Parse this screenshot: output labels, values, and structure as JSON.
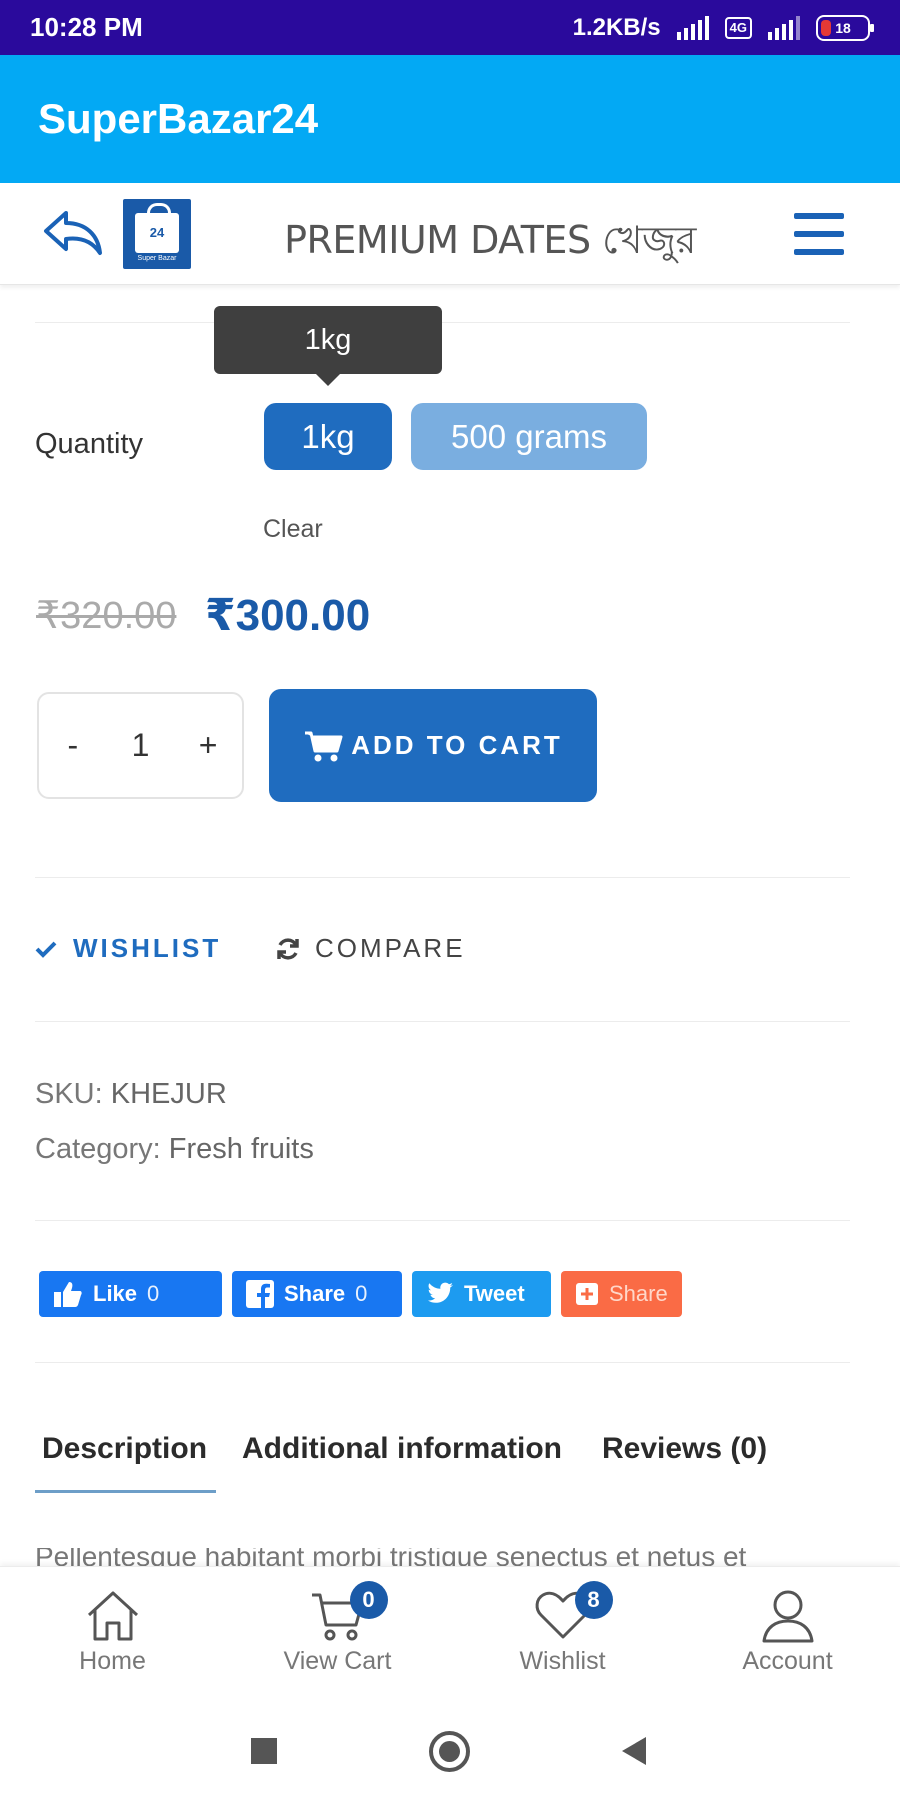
{
  "status_bar": {
    "time": "10:28 PM",
    "net_speed": "1.2KB/s",
    "lte": "4G",
    "battery": "18"
  },
  "app_bar": {
    "title": "SuperBazar24"
  },
  "header": {
    "title": "PREMIUM DATES খেজুর",
    "logo_number": "24",
    "logo_caption": "Super Bazar"
  },
  "tooltip": {
    "text": "1kg"
  },
  "quantity": {
    "label": "Quantity",
    "options": [
      {
        "label": "1kg",
        "selected": true
      },
      {
        "label": "500 grams",
        "selected": false
      }
    ],
    "clear_label": "Clear"
  },
  "price": {
    "old": "₹320.00",
    "new": "₹300.00"
  },
  "stepper": {
    "minus": "-",
    "value": "1",
    "plus": "+"
  },
  "cart": {
    "add_label": "ADD TO CART",
    "icon": "cart-icon"
  },
  "actions": {
    "wishlist_label": "WISHLIST",
    "compare_label": "COMPARE"
  },
  "meta": {
    "sku_label": "SKU:",
    "sku_value": "KHEJUR",
    "category_label": "Category:",
    "category_value": "Fresh fruits"
  },
  "share": {
    "fb_like_label": "Like",
    "fb_like_count": "0",
    "fb_share_label": "Share",
    "fb_share_count": "0",
    "tweet_label": "Tweet",
    "generic_share_label": "Share"
  },
  "tabs": [
    {
      "label": "Description",
      "active": true
    },
    {
      "label": "Additional information",
      "active": false
    },
    {
      "label": "Reviews (0)",
      "active": false
    }
  ],
  "description_peek": "Pellentesque habitant morbi tristique senectus et netus et",
  "bottom_nav": [
    {
      "label": "Home",
      "icon": "home-icon"
    },
    {
      "label": "View Cart",
      "icon": "cart-icon",
      "badge": "0"
    },
    {
      "label": "Wishlist",
      "icon": "heart-icon",
      "badge": "8"
    },
    {
      "label": "Account",
      "icon": "user-icon"
    }
  ],
  "colors": {
    "status_bar": "#2a0a9c",
    "app_bar": "#03a9f4",
    "primary": "#1f6cbf",
    "variant_light": "#7aaee0"
  }
}
